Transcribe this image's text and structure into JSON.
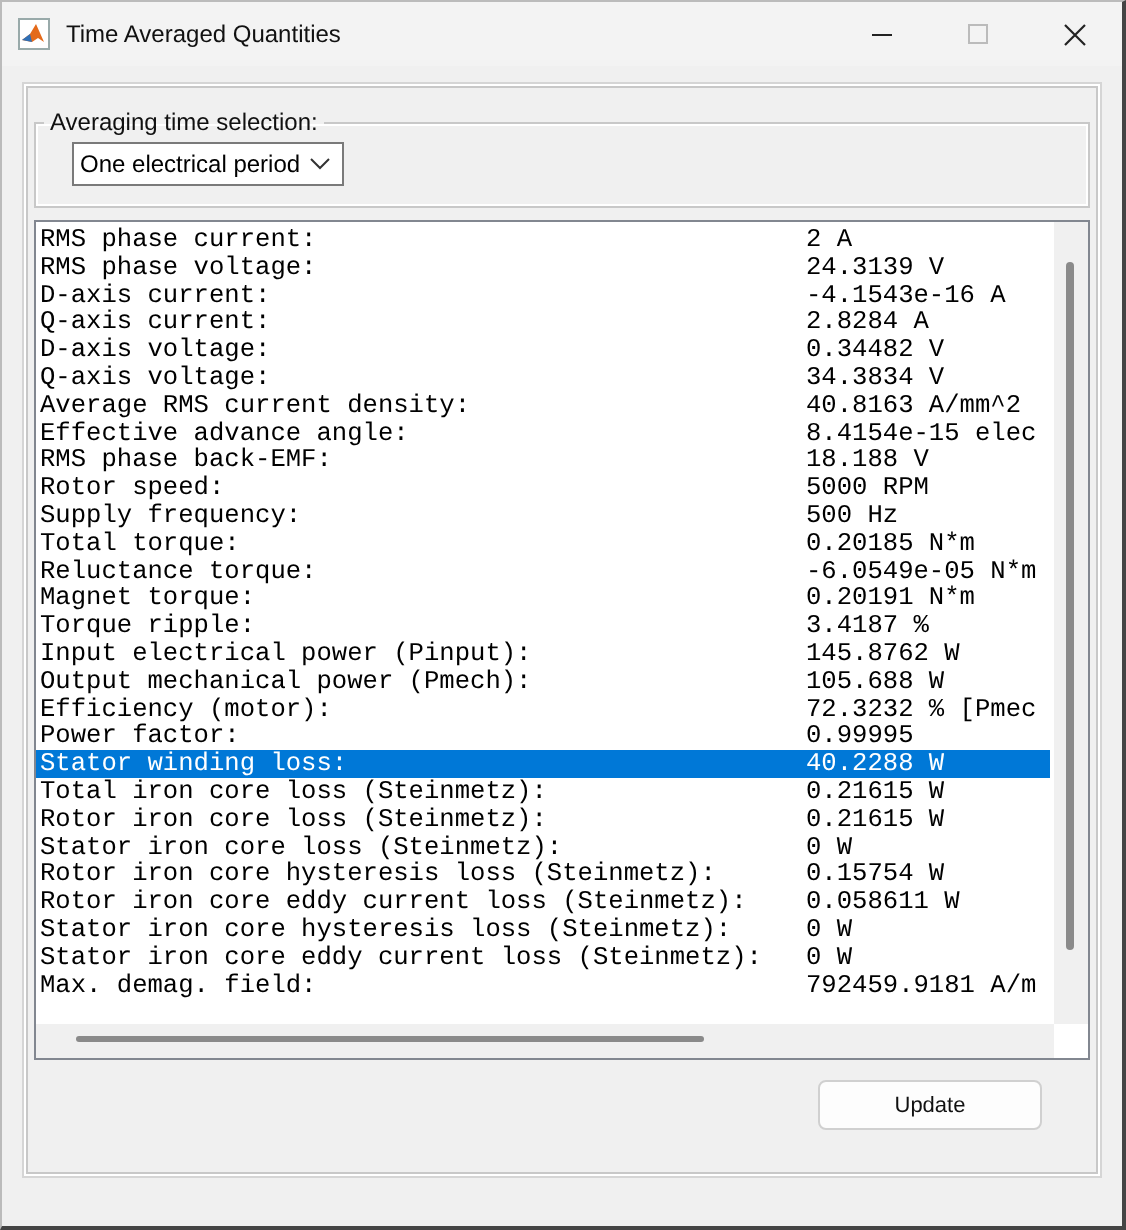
{
  "window": {
    "title": "Time Averaged Quantities"
  },
  "averaging_time_selection": {
    "label": "Averaging time selection:",
    "value": "One electrical period"
  },
  "results": [
    {
      "label": "RMS phase current:",
      "value": "2 A",
      "selected": false
    },
    {
      "label": "RMS phase voltage:",
      "value": "24.3139 V",
      "selected": false
    },
    {
      "label": "D-axis current:",
      "value": "-4.1543e-16 A",
      "selected": false
    },
    {
      "label": "Q-axis current:",
      "value": "2.8284 A",
      "selected": false
    },
    {
      "label": "D-axis voltage:",
      "value": "0.34482 V",
      "selected": false
    },
    {
      "label": "Q-axis voltage:",
      "value": "34.3834 V",
      "selected": false
    },
    {
      "label": "Average RMS current density:",
      "value": "40.8163 A/mm^2",
      "selected": false
    },
    {
      "label": "Effective advance angle:",
      "value": "8.4154e-15 elec",
      "selected": false
    },
    {
      "label": "RMS phase back-EMF:",
      "value": "18.188 V",
      "selected": false
    },
    {
      "label": "Rotor speed:",
      "value": "5000 RPM",
      "selected": false
    },
    {
      "label": "Supply frequency:",
      "value": "500 Hz",
      "selected": false
    },
    {
      "label": "Total torque:",
      "value": "0.20185 N*m",
      "selected": false
    },
    {
      "label": "Reluctance torque:",
      "value": "-6.0549e-05 N*m",
      "selected": false
    },
    {
      "label": "Magnet torque:",
      "value": "0.20191 N*m",
      "selected": false
    },
    {
      "label": "Torque ripple:",
      "value": "3.4187 %",
      "selected": false
    },
    {
      "label": "Input electrical power (Pinput):",
      "value": "145.8762 W",
      "selected": false
    },
    {
      "label": "Output mechanical power (Pmech):",
      "value": "105.688 W",
      "selected": false
    },
    {
      "label": "Efficiency (motor):",
      "value": "72.3232 % [Pmec",
      "selected": false
    },
    {
      "label": "Power factor:",
      "value": "0.99995",
      "selected": false
    },
    {
      "label": "Stator winding loss:",
      "value": "40.2288 W",
      "selected": true
    },
    {
      "label": "Total iron core loss (Steinmetz):",
      "value": "0.21615 W",
      "selected": false
    },
    {
      "label": "Rotor iron core loss (Steinmetz):",
      "value": "0.21615 W",
      "selected": false
    },
    {
      "label": "Stator iron core loss (Steinmetz):",
      "value": "0 W",
      "selected": false
    },
    {
      "label": "Rotor iron core hysteresis loss (Steinmetz):",
      "value": "0.15754 W",
      "selected": false
    },
    {
      "label": "Rotor iron core eddy current loss (Steinmetz):",
      "value": "0.058611 W",
      "selected": false
    },
    {
      "label": "Stator iron core hysteresis loss (Steinmetz):",
      "value": "0 W",
      "selected": false
    },
    {
      "label": "Stator iron core eddy current loss (Steinmetz):",
      "value": "0 W",
      "selected": false
    },
    {
      "label": "Max. demag. field:",
      "value": "792459.9181 A/m",
      "selected": false
    }
  ],
  "buttons": [
    "Update"
  ]
}
